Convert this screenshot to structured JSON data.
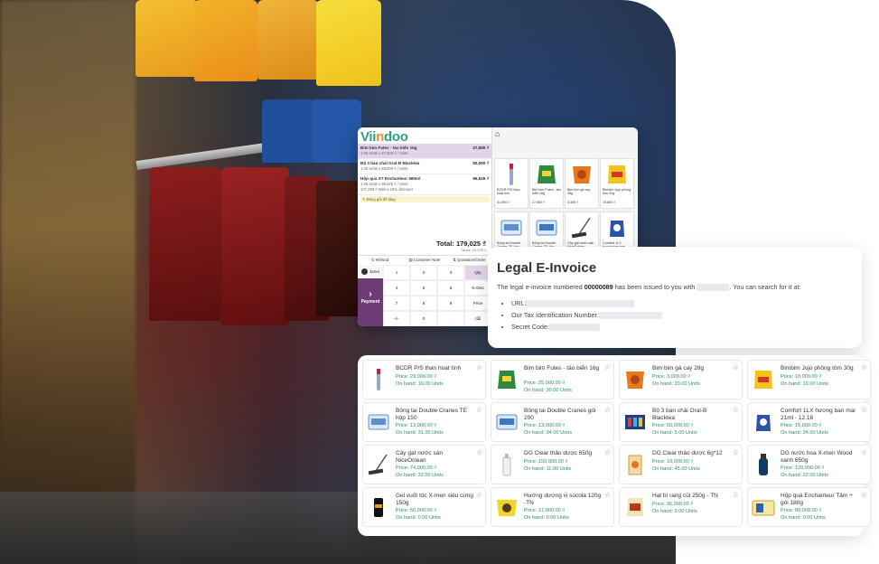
{
  "pos": {
    "brand_a": "Vii",
    "brand_o": "n",
    "brand_b": "doo",
    "home_icon": "home-icon",
    "order_lines": [
      {
        "name": "Bim bim Futes - tảo biển 16g",
        "price": "27,500 ₫",
        "detail": "1.00 Units x 27,500 ₫ / Units",
        "selected": true
      },
      {
        "name": "Bộ 3 bàn chải Oral-B Blacktea",
        "price": "50,000 ₫",
        "detail": "1.00 Units x 55,000 ₫ / Units",
        "selected": false
      },
      {
        "name": "Hộp quà ST Enchanteur 580ml",
        "price": "96,525 ₫",
        "detail": "1.00 Units x 96,525 ₫ / Units",
        "detail2": "107,250 ₫ With a 10% discount",
        "selected": false
      }
    ],
    "note": "Đóng gói để tặng",
    "total": "Total: 179,025 ₫",
    "taxes": "Taxes: 16,275 ₫",
    "actions": [
      "Refund",
      "Customer Note",
      "Quotation/Order"
    ],
    "customer": "Jenni",
    "payment": "Payment",
    "keys": [
      "1",
      "2",
      "3",
      "Qty",
      "4",
      "5",
      "6",
      "% Disc",
      "7",
      "8",
      "9",
      "Price",
      "+/-",
      "0",
      ".",
      "⌫"
    ],
    "products": [
      {
        "name": "BCDR P/S than hoạt tính",
        "price": "31,900 ₫"
      },
      {
        "name": "Bim bim Futes - tảo biển 16g",
        "price": "27,500 ₫"
      },
      {
        "name": "Bim bim gà cay 28g",
        "price": "3,300 ₫"
      },
      {
        "name": "Bimbim Jojo phồng tôm 30g",
        "price": "19,800 ₫"
      },
      {
        "name": "Bông tai Double Cranes TE hộp...",
        "price": ""
      },
      {
        "name": "Bông tai Double Cranes TE hộp...",
        "price": ""
      },
      {
        "name": "Cây gạt nước sàn NiceOclean",
        "price": ""
      },
      {
        "name": "Comfort 1LX hương ban mai...",
        "price": ""
      }
    ]
  },
  "invoice": {
    "title": "Legal E-Invoice",
    "text_a": "The legal e-invoice numbered",
    "number": "00000089",
    "text_b": "has been issued to you with",
    "text_c": ". You can search for it at:",
    "items": [
      "URL:",
      "Our Tax Identification Number:",
      "Secret Code:"
    ]
  },
  "product_list": [
    {
      "name": "BCDR P/S than hoạt tính",
      "price": "Price: 29,000.00 ₫",
      "onhand": "On hand: 10.00 Units"
    },
    {
      "name": "Bim bim Futes - tảo biển 16g",
      "price": "Price: 25,000.00 ₫",
      "onhand": "On hand: 30.00 Units"
    },
    {
      "name": "Bim bim gà cay 28g",
      "price": "Price: 3,000.00 ₫",
      "onhand": "On hand: 20.00 Units"
    },
    {
      "name": "Bimbim Jojo phồng tôm 30g",
      "price": "Price: 18,000.00 ₫",
      "onhand": "On hand: 19.00 Units"
    },
    {
      "name": "Bông tai Double Cranes TE hộp 150",
      "price": "Price: 13,000.00 ₫",
      "onhand": "On hand: 31.00 Units"
    },
    {
      "name": "Bông tai Double Cranes gói 200",
      "price": "Price: 13,000.00 ₫",
      "onhand": "On hand: 34.00 Units"
    },
    {
      "name": "Bộ 3 bàn chải Oral-B Blacktea",
      "price": "Price: 50,000.00 ₫",
      "onhand": "On hand: 5.00 Units"
    },
    {
      "name": "Comfort 1LX hương ban mai 21ml - 12.16",
      "price": "Price: 15,000.00 ₫",
      "onhand": "On hand: 34.00 Units"
    },
    {
      "name": "Cây gạt nước sàn NiceOclean",
      "price": "Price: 74,000.00 ₫",
      "onhand": "On hand: 22.00 Units"
    },
    {
      "name": "DG Clear thảo dược 650g",
      "price": "Price: 150,000.00 ₫",
      "onhand": "On hand: 11.00 Units"
    },
    {
      "name": "DG Clear thảo dược 6g*12",
      "price": "Price: 19,000.00 ₫",
      "onhand": "On hand: 45.00 Units"
    },
    {
      "name": "DG nước hoa X-men Wood xanh 650g",
      "price": "Price: 120,000.00 ₫",
      "onhand": "On hand: 22.00 Units"
    },
    {
      "name": "Gel vuốt tóc X-men siêu cứng 150g",
      "price": "Price: 50,000.00 ₫",
      "onhand": "On hand: 0.00 Units"
    },
    {
      "name": "Hướng dương vị socola 120g -TN",
      "price": "Price: 17,000.00 ₫",
      "onhand": "On hand: 0.00 Units"
    },
    {
      "name": "Hạt bí rang củi 250g - TN",
      "price": "Price: 36,000.00 ₫",
      "onhand": "On hand: 0.00 Units"
    },
    {
      "name": "Hộp quà Enchanteur Tâm + gói 180g",
      "price": "Price: 80,000.00 ₫",
      "onhand": "On hand: 0.00 Units"
    }
  ],
  "colors": {
    "brand_green": "#2aa07c",
    "brand_orange": "#fb8a2e",
    "payment_purple": "#6e3a74",
    "price_green": "#2e8a6d"
  }
}
